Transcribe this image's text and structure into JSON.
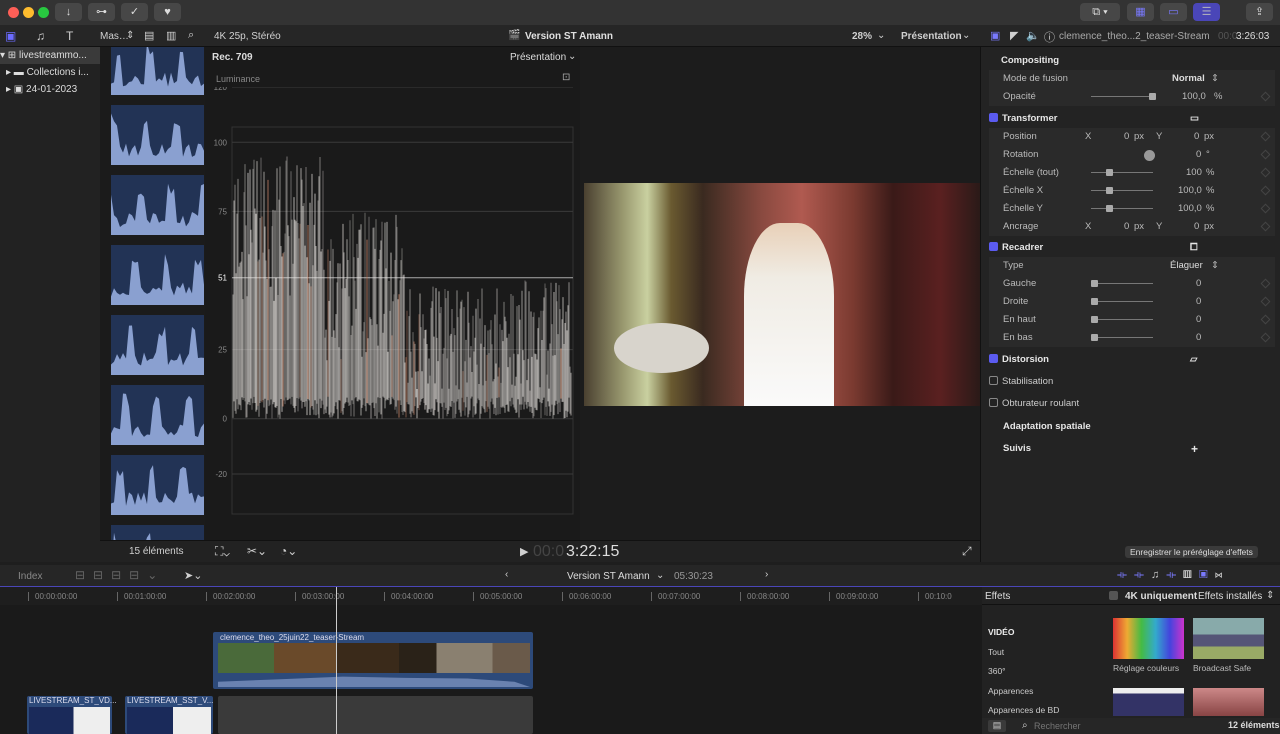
{
  "titlebar": {
    "buttons": [
      "↓",
      "⊶",
      "✓",
      "♥"
    ]
  },
  "library": {
    "filter": "Mas…",
    "items": [
      {
        "label": "livestreammo...",
        "expanded": true
      },
      {
        "label": "Collections i..."
      },
      {
        "label": "24-01-2023"
      }
    ],
    "count": "15 éléments"
  },
  "viewer": {
    "format": "4K 25p, Stéréo",
    "project": "Version ST Amann",
    "zoom": "28%",
    "display": "Présentation",
    "timecode_dim": "00:0",
    "timecode": "3:22:15"
  },
  "scope": {
    "colorspace": "Rec. 709",
    "display": "Présentation",
    "label": "Luminance",
    "ticks": [
      "120",
      "100",
      "75",
      "51",
      "25",
      "0",
      "-20"
    ]
  },
  "inspector": {
    "clip_name": "clemence_theo...2_teaser-Stream",
    "timecode_dim": "00:0",
    "timecode": "3:26:03",
    "compositing": "Compositing",
    "blend_label": "Mode de fusion",
    "blend_value": "Normal",
    "opacity_label": "Opacité",
    "opacity_value": "100,0",
    "opacity_unit": "%",
    "opacity": 1.0,
    "transform": "Transformer",
    "position_label": "Position",
    "x": "X",
    "y": "Y",
    "pos_x": "0",
    "pos_y": "0",
    "px": "px",
    "rotation_label": "Rotation",
    "rotation_value": "0",
    "deg": "°",
    "scale_all_label": "Échelle (tout)",
    "scale_all": "100",
    "scale_x_label": "Échelle X",
    "scale_x": "100,0",
    "scale_y_label": "Échelle Y",
    "scale_y": "100,0",
    "pct": "%",
    "anchor_label": "Ancrage",
    "anc_x": "0",
    "anc_y": "0",
    "crop": "Recadrer",
    "type_label": "Type",
    "type_value": "Élaguer",
    "left": "Gauche",
    "right": "Droite",
    "top": "En haut",
    "bottom": "En bas",
    "zero": "0",
    "distortion": "Distorsion",
    "stabilization": "Stabilisation",
    "rolling": "Obturateur roulant",
    "spatial": "Adaptation spatiale",
    "tracking": "Suivis",
    "plus": "+",
    "save_preset": "Enregistrer le préréglage d'effets"
  },
  "timeline": {
    "index": "Index",
    "project": "Version ST Amann",
    "duration": "05:30:23",
    "ruler": [
      "00:00:00:00",
      "00:01:00:00",
      "00:02:00:00",
      "00:03:00:00",
      "00:04:00:00",
      "00:05:00:00",
      "00:06:00:00",
      "00:07:00:00",
      "00:08:00:00",
      "00:09:00:00",
      "00:10:0"
    ],
    "clips": {
      "main": "clemence_theo_25juin22_teaser-Stream",
      "c1": "LIVESTREAM_ST_VD...",
      "c2": "LIVESTREAM_SST_V..."
    }
  },
  "effects": {
    "title": "Effets",
    "only4k": "4K uniquement",
    "installed": "Effets installés",
    "categories": [
      "VIDÉO",
      "Tout",
      "360°",
      "Apparences",
      "Apparences de BD"
    ],
    "items": [
      "Réglage couleurs",
      "Broadcast Safe"
    ],
    "search_placeholder": "Rechercher",
    "count": "12 éléments"
  },
  "colors": {
    "accent": "#5b5bf0",
    "clip": "#2d4a7a"
  }
}
